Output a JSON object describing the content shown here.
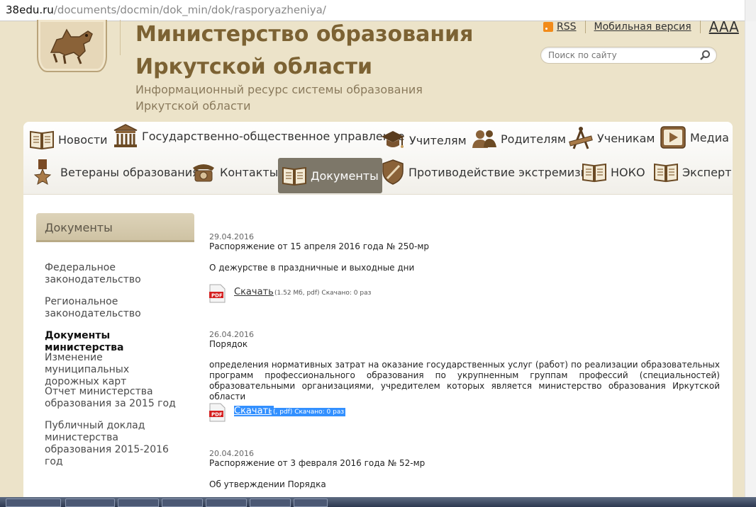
{
  "browser": {
    "url_host": "38edu.ru",
    "url_path": "/documents/docmin/dok_min/dok/rasporyazheniya/"
  },
  "header": {
    "title_line1": "Министерство образования",
    "title_line2": "Иркутской области",
    "subtitle_line1": "Информационный ресурс системы образования",
    "subtitle_line2": "Иркутской области",
    "rss_label": "RSS",
    "mobile_label": "Мобильная версия",
    "aaa_label": "AAA",
    "search_placeholder": "Поиск по сайту"
  },
  "nav": {
    "row1": [
      "Новости",
      "Государственно-общественное управление",
      "Учителям",
      "Родителям",
      "Ученикам",
      "Медиа"
    ],
    "row2": [
      "Ветераны образования",
      "Контакты",
      "Документы",
      "Противодействие экстремизму",
      "НОКО",
      "Эксперт"
    ],
    "active": "Документы"
  },
  "sidebar": {
    "heading": "Документы",
    "items": [
      "Федеральное законодательство",
      "Региональное законодательство",
      "Документы министерства",
      "Изменение муниципальных дорожных карт",
      "Отчет министерства образования за 2015 год",
      "Публичный доклад министерства образования 2015-2016 год"
    ],
    "active_item": "Документы министерства"
  },
  "documents": [
    {
      "date": "29.04.2016",
      "title": "Распоряжение от 15 апреля 2016 года № 250-мр",
      "description": "О дежурстве в праздничные и выходные дни",
      "download_label": "Скачать",
      "download_meta": "(1.52 Мб, pdf) Скачано: 0 раз"
    },
    {
      "date": "26.04.2016",
      "title": "Порядок",
      "description": "определения нормативных затрат на оказание государственных услуг (работ) по реализации образовательных программ профессионального образования по укрупненным группам профессий (специальностей) образовательными организациями, учредителем которых является министерство образования Иркутской области",
      "download_label": "Скачать",
      "download_meta": "(, pdf) Скачано: 0 раз"
    },
    {
      "date": "20.04.2016",
      "title": "Распоряжение от 3 февраля 2016 года № 52-мр",
      "description": "Об утверждении Порядка"
    }
  ],
  "colors": {
    "page_bg": "#ece3c9",
    "title_brown": "#7c6233",
    "active_tab": "#7d7769",
    "selection": "#3390ff"
  }
}
